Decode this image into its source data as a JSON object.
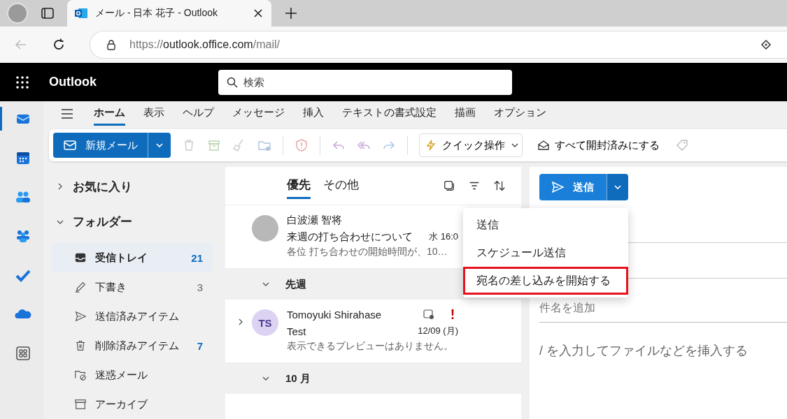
{
  "browser": {
    "tab_title": "メール - 日本 花子 - Outlook",
    "url_scheme": "https://",
    "url_host": "outlook.office.com",
    "url_path": "/mail/"
  },
  "app": {
    "name": "Outlook",
    "search_placeholder": "検索"
  },
  "rail": [
    {
      "kind": "mail",
      "selected": true
    },
    {
      "kind": "calendar",
      "selected": false
    },
    {
      "kind": "people",
      "selected": false
    },
    {
      "kind": "groups",
      "selected": false
    },
    {
      "kind": "todo",
      "selected": false
    },
    {
      "kind": "cloud",
      "selected": false
    },
    {
      "kind": "apps",
      "selected": false
    }
  ],
  "ribbon_tabs": [
    {
      "label": "ホーム",
      "selected": true
    },
    {
      "label": "表示",
      "selected": false
    },
    {
      "label": "ヘルプ",
      "selected": false
    },
    {
      "label": "メッセージ",
      "selected": false
    },
    {
      "label": "挿入",
      "selected": false
    },
    {
      "label": "テキストの書式設定",
      "selected": false
    },
    {
      "label": "描画",
      "selected": false
    },
    {
      "label": "オプション",
      "selected": false
    }
  ],
  "toolbar": {
    "new_mail": "新規メール",
    "quick_actions": "クイック操作",
    "mark_all_read": "すべて開封済みにする"
  },
  "folder_groups": [
    {
      "label": "お気に入り",
      "expanded": false
    },
    {
      "label": "フォルダー",
      "expanded": true
    }
  ],
  "folders": [
    {
      "kind": "inbox",
      "label": "受信トレイ",
      "count": "21",
      "unread": true,
      "selected": true
    },
    {
      "kind": "drafts",
      "label": "下書き",
      "count": "3",
      "unread": false,
      "selected": false
    },
    {
      "kind": "sent",
      "label": "送信済みアイテム",
      "selected": false
    },
    {
      "kind": "deleted",
      "label": "削除済みアイテム",
      "count": "7",
      "unread": true,
      "selected": false
    },
    {
      "kind": "junk",
      "label": "迷惑メール",
      "selected": false
    },
    {
      "kind": "archive",
      "label": "アーカイブ",
      "selected": false
    }
  ],
  "list_tabs": [
    {
      "label": "優先",
      "selected": true
    },
    {
      "label": "その他",
      "selected": false
    }
  ],
  "messages": [
    {
      "kind": "message",
      "sender": "白波瀬 智将",
      "subject": "来週の打ち合わせについて",
      "time": "水 16:0",
      "preview": "各位 打ち合わせの開始時間が、10…",
      "thread": false,
      "important": false
    },
    {
      "kind": "header",
      "label": "先週",
      "expanded": true
    },
    {
      "kind": "message",
      "initials": "TS",
      "sender": "Tomoyuki Shirahase",
      "subject": "Test",
      "time": "12/09 (月)",
      "preview": "表示できるプレビューはありません。",
      "thread": true,
      "important": true
    },
    {
      "kind": "header",
      "label": "10 月",
      "expanded": true
    }
  ],
  "compose": {
    "send": "送信",
    "subject_placeholder": "件名を追加",
    "body_placeholder": "/ を入力してファイルなどを挿入する"
  },
  "send_menu": [
    {
      "label": "送信",
      "highlighted": false
    },
    {
      "label": "スケジュール送信",
      "highlighted": false
    },
    {
      "label": "宛名の差し込みを開始する",
      "highlighted": true
    }
  ]
}
